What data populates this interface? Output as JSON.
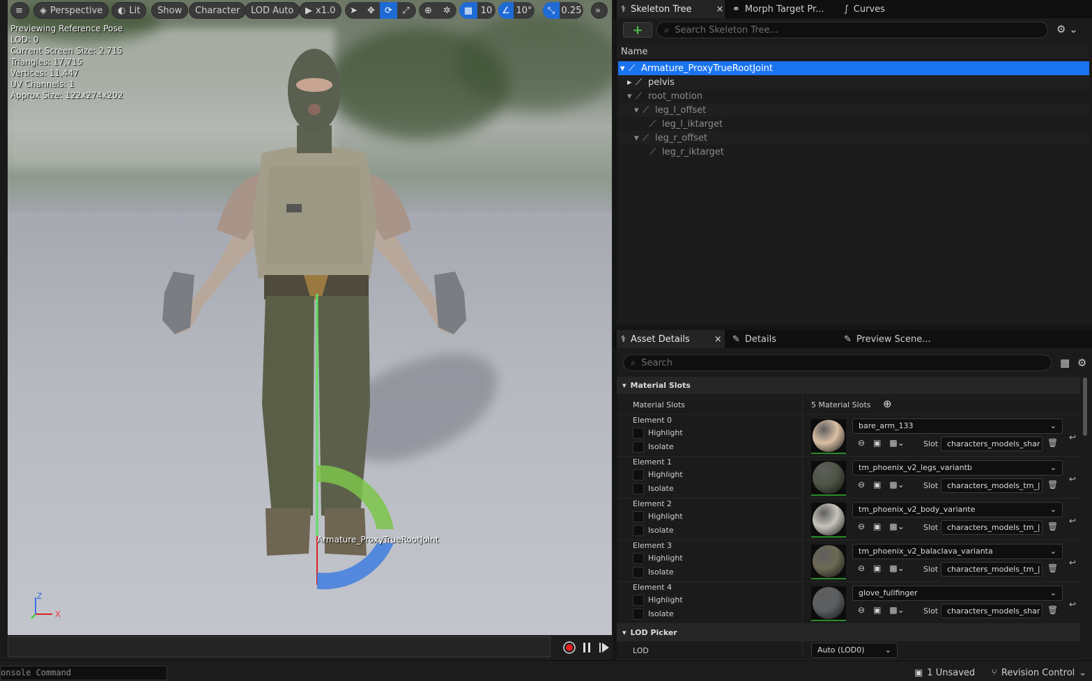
{
  "viewport": {
    "toolbar": {
      "menu_icon": "hamburger-icon",
      "perspective": "Perspective",
      "lit": "Lit",
      "show": "Show",
      "character": "Character",
      "lod": "LOD Auto",
      "play_speed": "x1.0",
      "grid_snap": "10",
      "angle_snap": "10°",
      "scale_snap": "0.25"
    },
    "stats": {
      "line1": "Previewing Reference Pose",
      "line2": "LOD: 0",
      "line3": "Current Screen Size: 2.715",
      "line4": "Triangles: 17,715",
      "line5": "Vertices: 11,447",
      "line6": "UV Channels: 1",
      "line7": "Approx Size: 122x274x202"
    },
    "bone_label": "Armature_ProxyTrueRootJoint",
    "axis": {
      "z": "Z",
      "x": "X"
    }
  },
  "statusbar": {
    "console": "onsole Command",
    "unsaved": "1 Unsaved",
    "revision": "Revision Control"
  },
  "skeleton_panel": {
    "tabs": [
      {
        "label": "Skeleton Tree",
        "active": true
      },
      {
        "label": "Morph Target Pr..."
      },
      {
        "label": "Curves"
      }
    ],
    "close_glyph": "×",
    "search_placeholder": "Search Skeleton Tree...",
    "column_name": "Name",
    "rows": [
      {
        "label": "Armature_ProxyTrueRootJoint",
        "depth": 0,
        "selected": true
      },
      {
        "label": "pelvis",
        "depth": 1
      },
      {
        "label": "root_motion",
        "depth": 1
      },
      {
        "label": "leg_l_offset",
        "depth": 2
      },
      {
        "label": "leg_l_iktarget",
        "depth": 3
      },
      {
        "label": "leg_r_offset",
        "depth": 2
      },
      {
        "label": "leg_r_iktarget",
        "depth": 3
      }
    ]
  },
  "details_panel": {
    "tabs": [
      {
        "label": "Asset Details",
        "active": true
      },
      {
        "label": "Details"
      },
      {
        "label": "Preview Scene..."
      }
    ],
    "search_placeholder": "Search",
    "material_section": "Material Slots",
    "material_slots_label": "Material Slots",
    "material_slots_count": "5 Material Slots",
    "highlight_label": "Highlight",
    "isolate_label": "Isolate",
    "slot_label": "Slot",
    "elements": [
      {
        "name": "Element 0",
        "material": "bare_arm_133",
        "slot": "characters_models_shar",
        "color": "#d9bfa3"
      },
      {
        "name": "Element 1",
        "material": "tm_phoenix_v2_legs_variantb",
        "slot": "characters_models_tm_|",
        "color": "#4e5545"
      },
      {
        "name": "Element 2",
        "material": "tm_phoenix_v2_body_variante",
        "slot": "characters_models_tm_|",
        "color": "#c8c4bc"
      },
      {
        "name": "Element 3",
        "material": "tm_phoenix_v2_balaclava_varianta",
        "slot": "characters_models_tm_|",
        "color": "#6d6a54"
      },
      {
        "name": "Element 4",
        "material": "glove_fullfinger",
        "slot": "characters_models_shar",
        "color": "#5b5f63"
      }
    ],
    "lod_section": "LOD Picker",
    "lod_label": "LOD",
    "lod_value": "Auto (LOD0)"
  }
}
